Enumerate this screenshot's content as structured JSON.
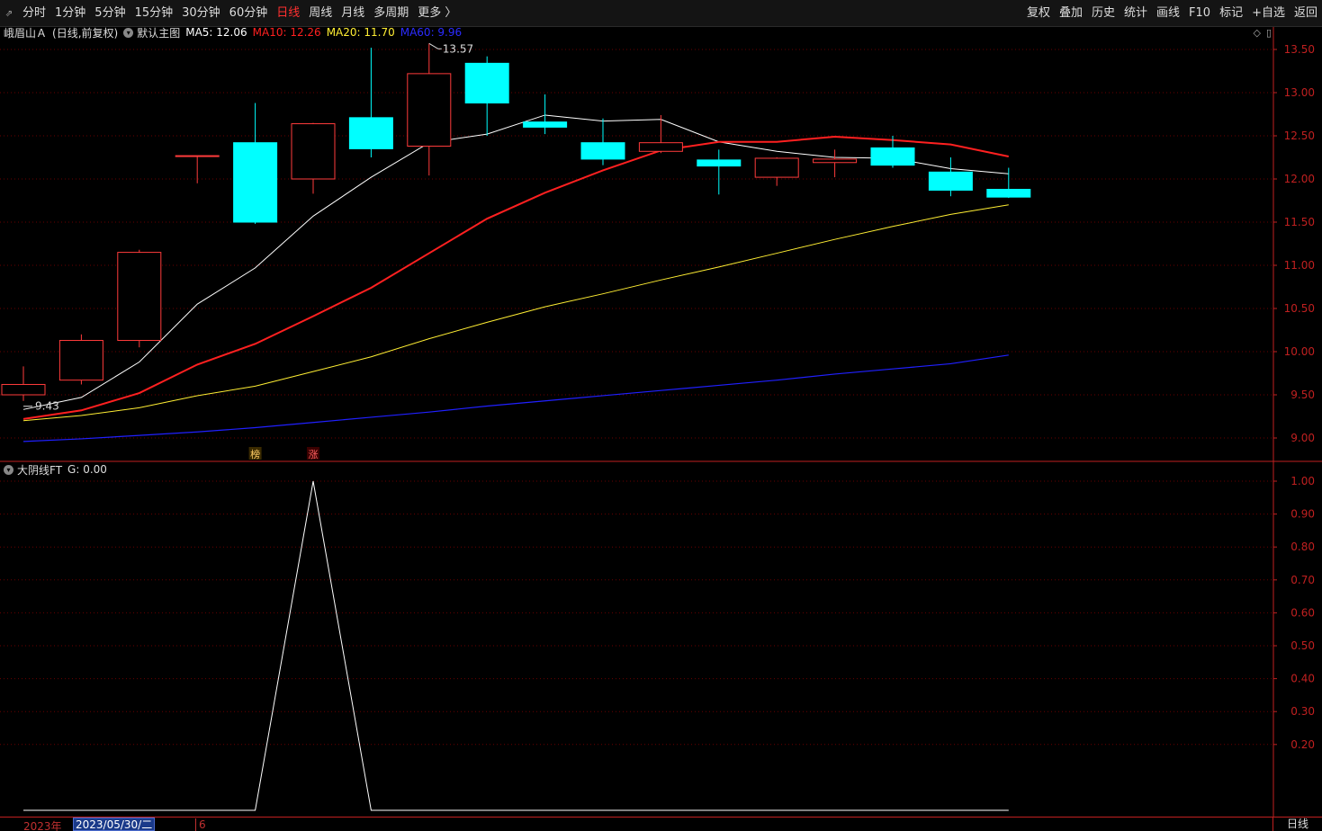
{
  "toolbar": {
    "toggle_glyph": "⇗",
    "periods": [
      {
        "label": "分时",
        "active": false
      },
      {
        "label": "1分钟",
        "active": false
      },
      {
        "label": "5分钟",
        "active": false
      },
      {
        "label": "15分钟",
        "active": false
      },
      {
        "label": "30分钟",
        "active": false
      },
      {
        "label": "60分钟",
        "active": false
      },
      {
        "label": "日线",
        "active": true
      },
      {
        "label": "周线",
        "active": false
      },
      {
        "label": "月线",
        "active": false
      },
      {
        "label": "多周期",
        "active": false
      },
      {
        "label": "更多 〉",
        "active": false
      }
    ],
    "right_buttons": [
      "复权",
      "叠加",
      "历史",
      "统计",
      "画线",
      "F10",
      "标记",
      "+自选",
      "返回"
    ]
  },
  "main_panel": {
    "stock_name": "峨眉山Ａ",
    "mode": "(日线,前复权)",
    "template": "默认主图",
    "ma5": {
      "label": "MA5: 12.06",
      "color": "#ffffff"
    },
    "ma10": {
      "label": "MA10: 12.26",
      "color": "#ff2020"
    },
    "ma20": {
      "label": "MA20: 11.70",
      "color": "#ffee33"
    },
    "ma60": {
      "label": "MA60: 9.96",
      "color": "#2020ff"
    },
    "high_label": "13.57",
    "low_label": "9.43",
    "markers": [
      "榜",
      "涨"
    ]
  },
  "sub_panel": {
    "title": "大阴线FT",
    "value_label": "G: 0.00"
  },
  "bottom_bar": {
    "year": "2023年",
    "cursor_date": "2023/05/30/二",
    "month": "6",
    "period_tag": "日线"
  },
  "colors": {
    "up": "#ff3b3b",
    "down": "#00ffff",
    "axis": "#c02020",
    "grid": "#6a0000"
  },
  "chart_data": [
    {
      "type": "candlestick",
      "ylim": [
        8.75,
        13.75
      ],
      "y_ticks": [
        13.5,
        13.0,
        12.5,
        12.0,
        11.5,
        11.0,
        10.5,
        10.0,
        9.5,
        9.0
      ],
      "candles": [
        {
          "o": 9.5,
          "h": 9.83,
          "l": 9.43,
          "c": 9.62
        },
        {
          "o": 9.67,
          "h": 10.2,
          "l": 9.62,
          "c": 10.13
        },
        {
          "o": 10.13,
          "h": 11.18,
          "l": 10.05,
          "c": 11.15
        },
        {
          "o": 12.27,
          "h": 12.27,
          "l": 11.95,
          "c": 12.27
        },
        {
          "o": 12.42,
          "h": 12.88,
          "l": 11.48,
          "c": 11.5
        },
        {
          "o": 12.0,
          "h": 12.65,
          "l": 11.83,
          "c": 12.64
        },
        {
          "o": 12.71,
          "h": 13.52,
          "l": 12.25,
          "c": 12.35
        },
        {
          "o": 12.38,
          "h": 13.57,
          "l": 12.04,
          "c": 13.22
        },
        {
          "o": 13.34,
          "h": 13.42,
          "l": 12.5,
          "c": 12.88
        },
        {
          "o": 12.66,
          "h": 12.98,
          "l": 12.52,
          "c": 12.6
        },
        {
          "o": 12.42,
          "h": 12.7,
          "l": 12.16,
          "c": 12.23
        },
        {
          "o": 12.32,
          "h": 12.74,
          "l": 12.3,
          "c": 12.42
        },
        {
          "o": 12.22,
          "h": 12.34,
          "l": 11.82,
          "c": 12.15
        },
        {
          "o": 12.02,
          "h": 12.25,
          "l": 11.92,
          "c": 12.24
        },
        {
          "o": 12.19,
          "h": 12.34,
          "l": 12.02,
          "c": 12.23
        },
        {
          "o": 12.36,
          "h": 12.5,
          "l": 12.13,
          "c": 12.16
        },
        {
          "o": 12.08,
          "h": 12.25,
          "l": 11.8,
          "c": 11.87
        },
        {
          "o": 11.88,
          "h": 12.13,
          "l": 11.78,
          "c": 11.79
        }
      ],
      "series": [
        {
          "name": "MA5",
          "values": [
            9.33,
            9.47,
            9.88,
            10.55,
            10.97,
            11.57,
            12.02,
            12.42,
            12.52,
            12.74,
            12.67,
            12.69,
            12.43,
            12.32,
            12.25,
            12.24,
            12.12,
            12.06
          ]
        },
        {
          "name": "MA10",
          "values": [
            9.22,
            9.32,
            9.52,
            9.85,
            10.09,
            10.41,
            10.74,
            11.14,
            11.54,
            11.84,
            12.1,
            12.33,
            12.43,
            12.43,
            12.49,
            12.45,
            12.4,
            12.26
          ]
        },
        {
          "name": "MA20",
          "values": [
            9.2,
            9.26,
            9.35,
            9.49,
            9.6,
            9.77,
            9.94,
            10.15,
            10.34,
            10.52,
            10.67,
            10.83,
            10.98,
            11.14,
            11.3,
            11.45,
            11.59,
            11.7
          ]
        },
        {
          "name": "MA60",
          "values": [
            8.96,
            8.99,
            9.03,
            9.07,
            9.12,
            9.18,
            9.24,
            9.3,
            9.37,
            9.43,
            9.49,
            9.55,
            9.61,
            9.67,
            9.74,
            9.8,
            9.86,
            9.96
          ]
        }
      ]
    },
    {
      "type": "line",
      "ylim": [
        0.0,
        1.04
      ],
      "y_ticks": [
        1.0,
        0.9,
        0.8,
        0.7,
        0.6,
        0.5,
        0.4,
        0.3,
        0.2
      ],
      "series": [
        {
          "name": "G",
          "values": [
            0,
            0,
            0,
            0,
            0,
            1,
            0,
            0,
            0,
            0,
            0,
            0,
            0,
            0,
            0,
            0,
            0,
            0
          ]
        }
      ]
    }
  ]
}
